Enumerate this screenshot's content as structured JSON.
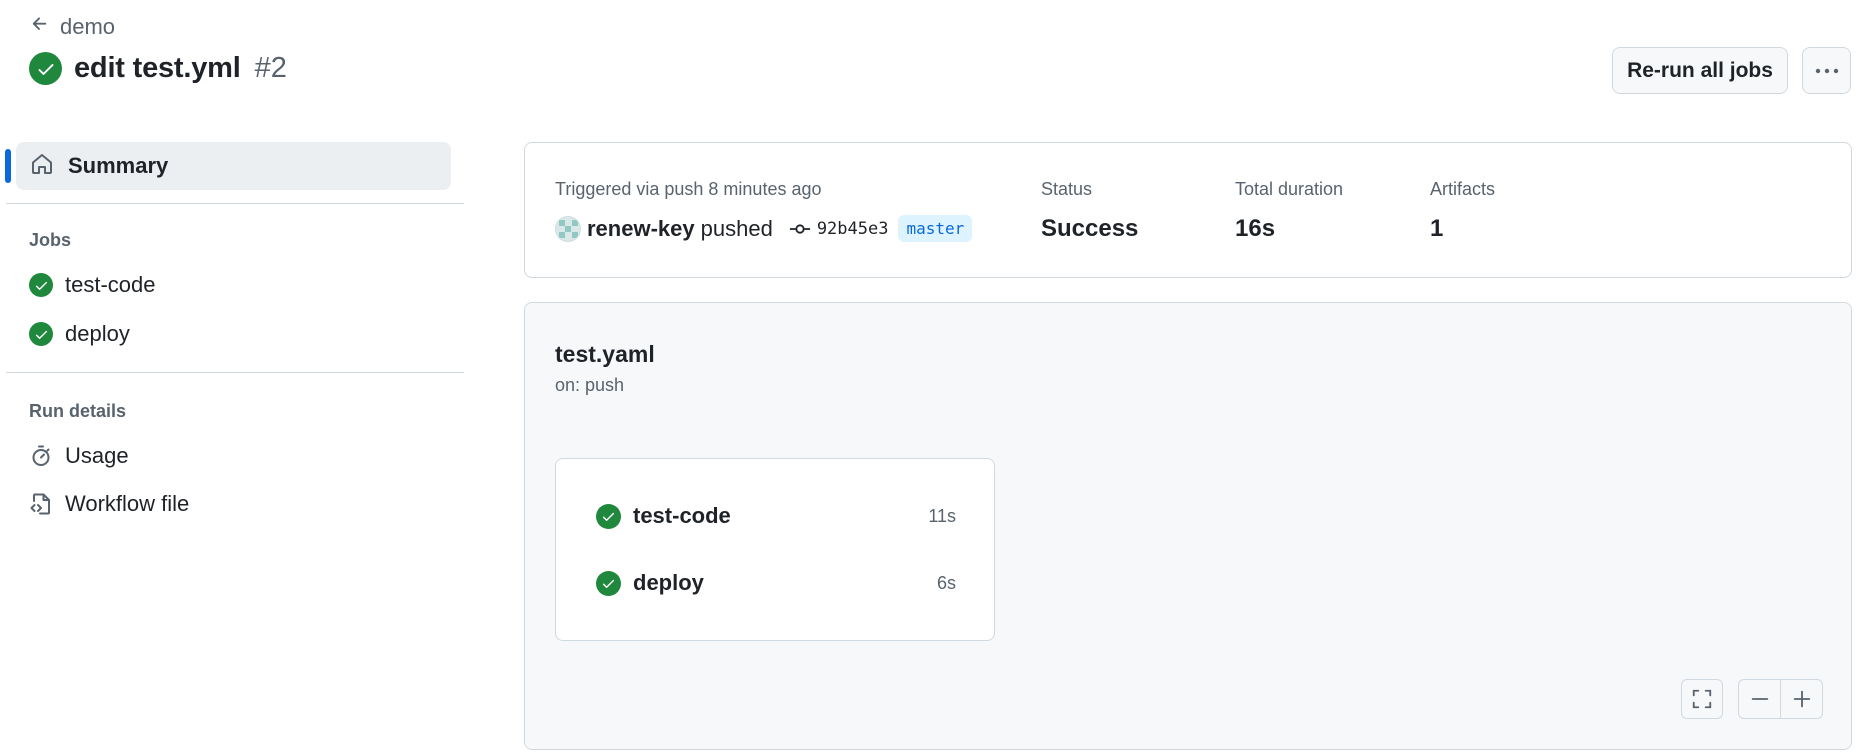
{
  "header": {
    "back_label": "demo",
    "title": "edit test.yml",
    "run_number": "#2",
    "rerun_label": "Re-run all jobs"
  },
  "sidebar": {
    "summary_label": "Summary",
    "jobs_heading": "Jobs",
    "jobs": [
      {
        "label": "test-code",
        "status": "success"
      },
      {
        "label": "deploy",
        "status": "success"
      }
    ],
    "run_details_heading": "Run details",
    "run_details": [
      {
        "label": "Usage",
        "icon": "stopwatch-icon"
      },
      {
        "label": "Workflow file",
        "icon": "file-code-icon"
      }
    ]
  },
  "summary": {
    "trigger_text": "Triggered via push 8 minutes ago",
    "actor": "renew-key",
    "action": "pushed",
    "commit_sha": "92b45e3",
    "branch": "master",
    "status_label": "Status",
    "status_value": "Success",
    "duration_label": "Total duration",
    "duration_value": "16s",
    "artifacts_label": "Artifacts",
    "artifacts_value": "1"
  },
  "graph": {
    "workflow_name": "test.yaml",
    "trigger": "on: push",
    "jobs": [
      {
        "name": "test-code",
        "duration": "11s",
        "status": "success"
      },
      {
        "name": "deploy",
        "duration": "6s",
        "status": "success"
      }
    ]
  },
  "colors": {
    "success": "#1f883d",
    "accent": "#0969da",
    "muted_text": "#59636e",
    "border": "#d1d9e0"
  }
}
